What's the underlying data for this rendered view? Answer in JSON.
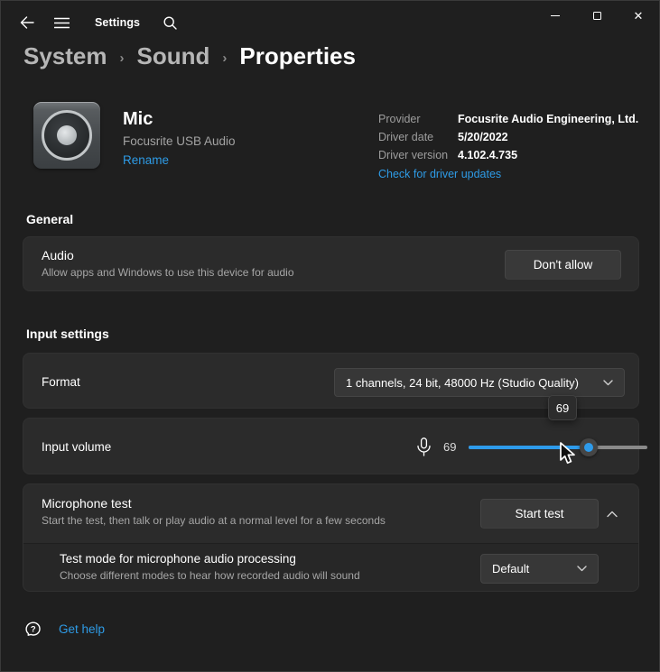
{
  "colors": {
    "accent": "#2e9beb",
    "link": "#2e9be6",
    "page_bg": "#1f1f1f",
    "card_bg": "#2b2b2b"
  },
  "titlebar": {
    "app_label": "Settings"
  },
  "breadcrumb": {
    "level1": "System",
    "level2": "Sound",
    "level3": "Properties",
    "separator": "›"
  },
  "device": {
    "name": "Mic",
    "subtitle": "Focusrite USB Audio",
    "rename_label": "Rename"
  },
  "driver_info": {
    "rows": [
      {
        "label": "Provider",
        "value": "Focusrite Audio Engineering, Ltd."
      },
      {
        "label": "Driver date",
        "value": "5/20/2022"
      },
      {
        "label": "Driver version",
        "value": "4.102.4.735"
      }
    ],
    "update_link": "Check for driver updates"
  },
  "general": {
    "section_title": "General",
    "audio": {
      "title": "Audio",
      "description": "Allow apps and Windows to use this device for audio",
      "button_label": "Don't allow"
    }
  },
  "input_settings": {
    "section_title": "Input settings",
    "format": {
      "label": "Format",
      "value": "1 channels, 24 bit, 48000 Hz (Studio Quality)"
    },
    "input_volume": {
      "label": "Input volume",
      "value": "69",
      "tooltip": "69",
      "percent": 67
    },
    "microphone_test": {
      "title": "Microphone test",
      "description": "Start the test, then talk or play audio at a normal level for a few seconds",
      "button_label": "Start test",
      "test_mode": {
        "title": "Test mode for microphone audio processing",
        "description": "Choose different modes to hear how recorded audio will sound",
        "value": "Default"
      }
    }
  },
  "footer": {
    "get_help_label": "Get help"
  }
}
